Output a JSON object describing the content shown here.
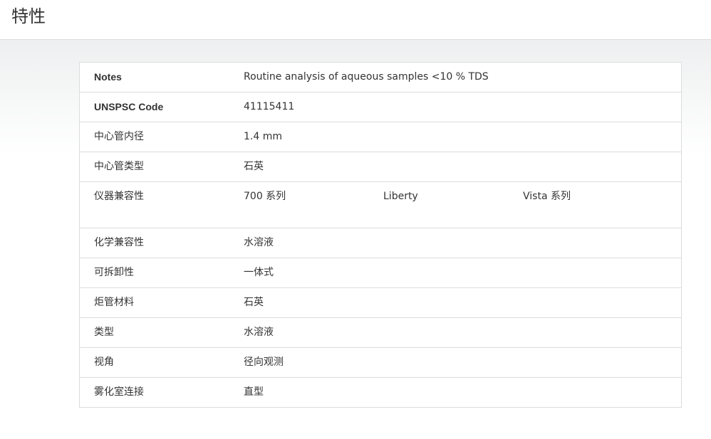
{
  "page": {
    "title": "特性"
  },
  "specs": {
    "rows": [
      {
        "label": "Notes",
        "values": [
          "Routine analysis of aqueous samples <10 % TDS"
        ]
      },
      {
        "label": "UNSPSC Code",
        "values": [
          "41115411"
        ]
      },
      {
        "label": "中心管内径",
        "values": [
          "1.4 mm"
        ]
      },
      {
        "label": "中心管类型",
        "values": [
          "石英"
        ]
      },
      {
        "label": "仪器兼容性",
        "values": [
          "700 系列",
          "Liberty",
          "Vista 系列"
        ]
      },
      {
        "label": "化学兼容性",
        "values": [
          "水溶液"
        ]
      },
      {
        "label": "可拆卸性",
        "values": [
          "一体式"
        ]
      },
      {
        "label": "炬管材料",
        "values": [
          "石英"
        ]
      },
      {
        "label": "类型",
        "values": [
          "水溶液"
        ]
      },
      {
        "label": "视角",
        "values": [
          "径向观测"
        ]
      },
      {
        "label": "雾化室连接",
        "values": [
          "直型"
        ]
      }
    ]
  }
}
